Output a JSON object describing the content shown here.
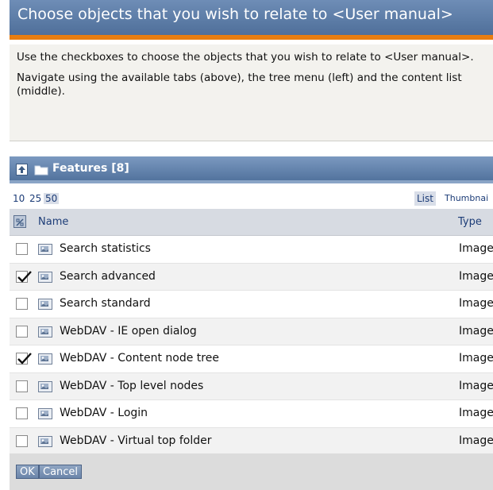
{
  "header": {
    "title": "Choose objects that you wish to relate to <User manual>"
  },
  "description": {
    "line1": "Use the checkboxes to choose the objects that you wish to relate to <User manual>.",
    "line2": "Navigate using the available tabs (above), the tree menu (left) and the content list (middle)."
  },
  "list": {
    "title": "Features [8]",
    "limits": [
      "10",
      "25",
      "50"
    ],
    "selected_limit": "50",
    "views": {
      "list": "List",
      "thumbnail": "Thumbnai"
    },
    "columns": {
      "name": "Name",
      "type": "Type"
    },
    "rows": [
      {
        "name": "Search statistics",
        "type": "Image",
        "checked": false
      },
      {
        "name": "Search advanced",
        "type": "Image",
        "checked": true
      },
      {
        "name": "Search standard",
        "type": "Image",
        "checked": false
      },
      {
        "name": "WebDAV - IE open dialog",
        "type": "Image",
        "checked": false
      },
      {
        "name": "WebDAV - Content node tree",
        "type": "Image",
        "checked": true
      },
      {
        "name": "WebDAV - Top level nodes",
        "type": "Image",
        "checked": false
      },
      {
        "name": "WebDAV - Login",
        "type": "Image",
        "checked": false
      },
      {
        "name": "WebDAV - Virtual top folder",
        "type": "Image",
        "checked": false
      }
    ]
  },
  "footer": {
    "ok": "OK",
    "cancel": "Cancel"
  },
  "colors": {
    "header": "#5a7aa6",
    "accent": "#e77d11",
    "link": "#1c3c77"
  }
}
